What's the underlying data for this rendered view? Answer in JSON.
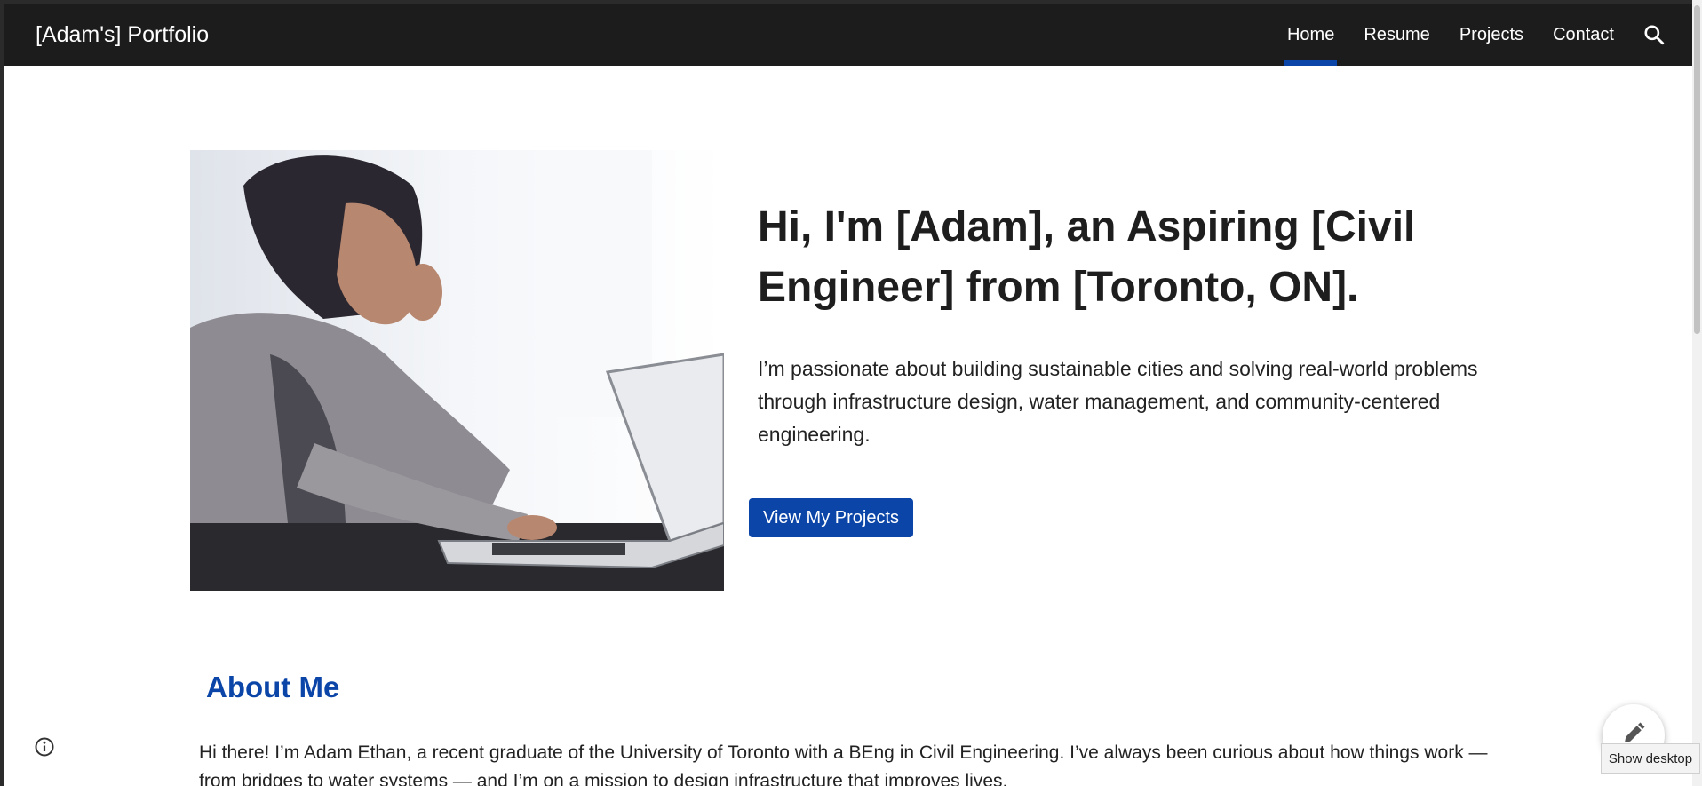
{
  "header": {
    "brand": "[Adam's] Portfolio",
    "nav": [
      {
        "label": "Home",
        "active": true
      },
      {
        "label": "Resume",
        "active": false
      },
      {
        "label": "Projects",
        "active": false
      },
      {
        "label": "Contact",
        "active": false
      }
    ],
    "search_icon": "search-icon"
  },
  "hero": {
    "title": "Hi, I'm [Adam], an Aspiring [Civil Engineer] from [Toronto, ON].",
    "description": "I’m passionate about building sustainable cities and solving real-world problems through infrastructure design, water management, and community-centered engineering.",
    "cta_label": "View My Projects",
    "image": "woman-typing-on-laptop-photo"
  },
  "about": {
    "title": "About Me",
    "text": "Hi there! I’m Adam Ethan, a recent graduate of the University of Toronto with a BEng in Civil Engineering. I’ve always been curious about how things work — from bridges to water systems — and I’m on a mission to design infrastructure that improves lives."
  },
  "overlay": {
    "info_icon": "info-icon",
    "edit_icon": "pencil-icon",
    "tooltip": "Show desktop"
  },
  "colors": {
    "header_bg": "#1c1c1c",
    "accent": "#0b45a8",
    "text": "#212121"
  }
}
